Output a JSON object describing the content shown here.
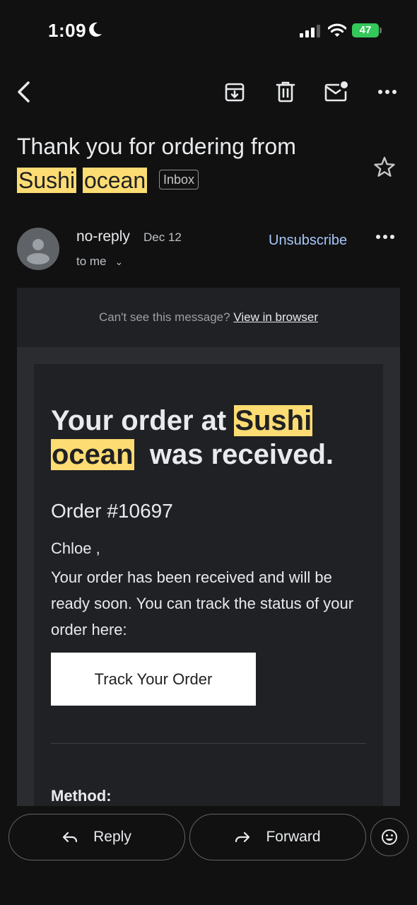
{
  "status_bar": {
    "time": "1:09",
    "battery": "47"
  },
  "subject": {
    "prefix": "Thank you for ordering from",
    "highlight_1": "Sushi",
    "highlight_2": "ocean",
    "badge": "Inbox"
  },
  "sender": {
    "name": "no-reply",
    "date": "Dec 12",
    "recipient": "to me",
    "unsubscribe_label": "Unsubscribe"
  },
  "email": {
    "preheader_text": "Can't see this message?",
    "preheader_link": "View in browser",
    "headline_prefix": "Your order at",
    "headline_highlight_1": "Sushi",
    "headline_highlight_2": "ocean",
    "headline_suffix": "was received.",
    "order_number": "Order #10697",
    "greeting": "Chloe ,",
    "body": "Your order has been received and will be ready soon. You can track the status of your order here:",
    "track_button": "Track Your Order",
    "method_label": "Method:"
  },
  "actions": {
    "reply_label": "Reply",
    "forward_label": "Forward"
  },
  "colors": {
    "background": "#111111",
    "highlight": "#fddc73",
    "link_blue": "#a8c7fa",
    "battery_green": "#34c759"
  }
}
